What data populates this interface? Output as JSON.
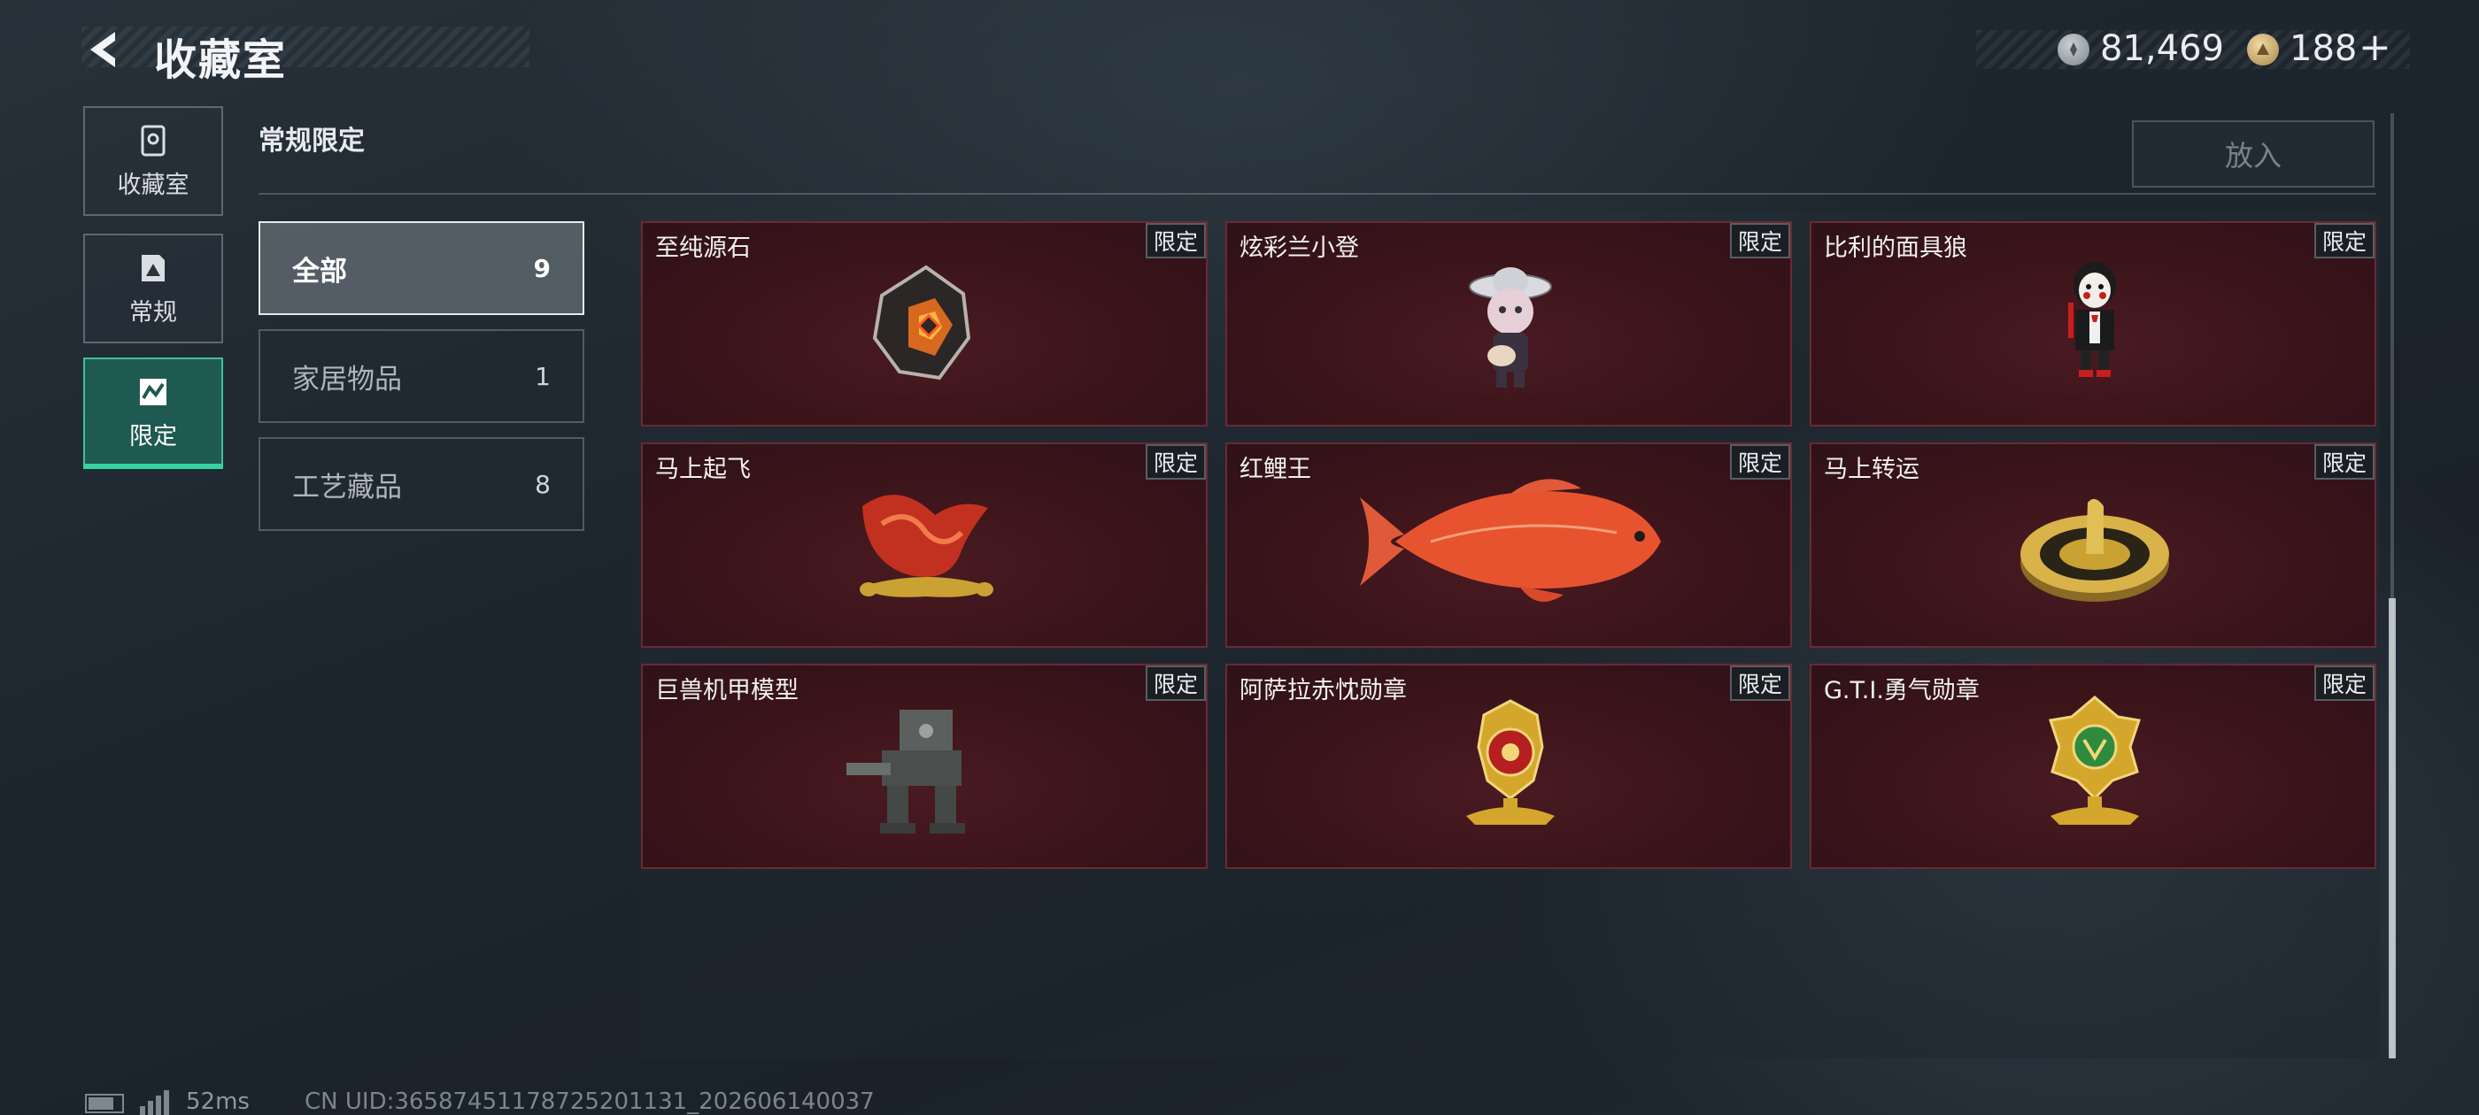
{
  "header": {
    "title": "收藏室",
    "currency": [
      {
        "icon": "silver-coin-icon",
        "value": "81,469"
      },
      {
        "icon": "gold-coin-icon",
        "value": "188"
      }
    ],
    "plus_label": "+"
  },
  "nav": {
    "items": [
      {
        "label": "收藏室",
        "icon": "collection-icon"
      },
      {
        "label": "常规",
        "icon": "regular-icon"
      },
      {
        "label": "限定",
        "icon": "limited-icon",
        "active": true
      }
    ]
  },
  "section": {
    "title": "常规限定",
    "put_in_label": "放入"
  },
  "categories": [
    {
      "label": "全部",
      "count": "9",
      "active": true
    },
    {
      "label": "家居物品",
      "count": "1"
    },
    {
      "label": "工艺藏品",
      "count": "8"
    }
  ],
  "items": [
    {
      "name": "至纯源石",
      "tag": "限定",
      "icon": "gem-stone-icon"
    },
    {
      "name": "炫彩兰小登",
      "tag": "限定",
      "icon": "figurine-icon"
    },
    {
      "name": "比利的面具狼",
      "tag": "限定",
      "icon": "puppet-figure-icon"
    },
    {
      "name": "马上起飞",
      "tag": "限定",
      "icon": "horse-statue-icon"
    },
    {
      "name": "红鲤王",
      "tag": "限定",
      "icon": "red-carp-icon"
    },
    {
      "name": "马上转运",
      "tag": "限定",
      "icon": "golden-disc-icon"
    },
    {
      "name": "巨兽机甲模型",
      "tag": "限定",
      "icon": "mech-model-icon"
    },
    {
      "name": "阿萨拉赤忱勋章",
      "tag": "限定",
      "icon": "red-medal-icon"
    },
    {
      "name": "G.T.I.勇气勋章",
      "tag": "限定",
      "icon": "green-medal-icon"
    }
  ],
  "status": {
    "ping": "52ms",
    "uid": "CN UID:3658745117872520113​1_202606140037"
  },
  "colors": {
    "accent": "#35d39f",
    "card_bg": "#3a1419",
    "active_nav": "#1f5a52"
  }
}
